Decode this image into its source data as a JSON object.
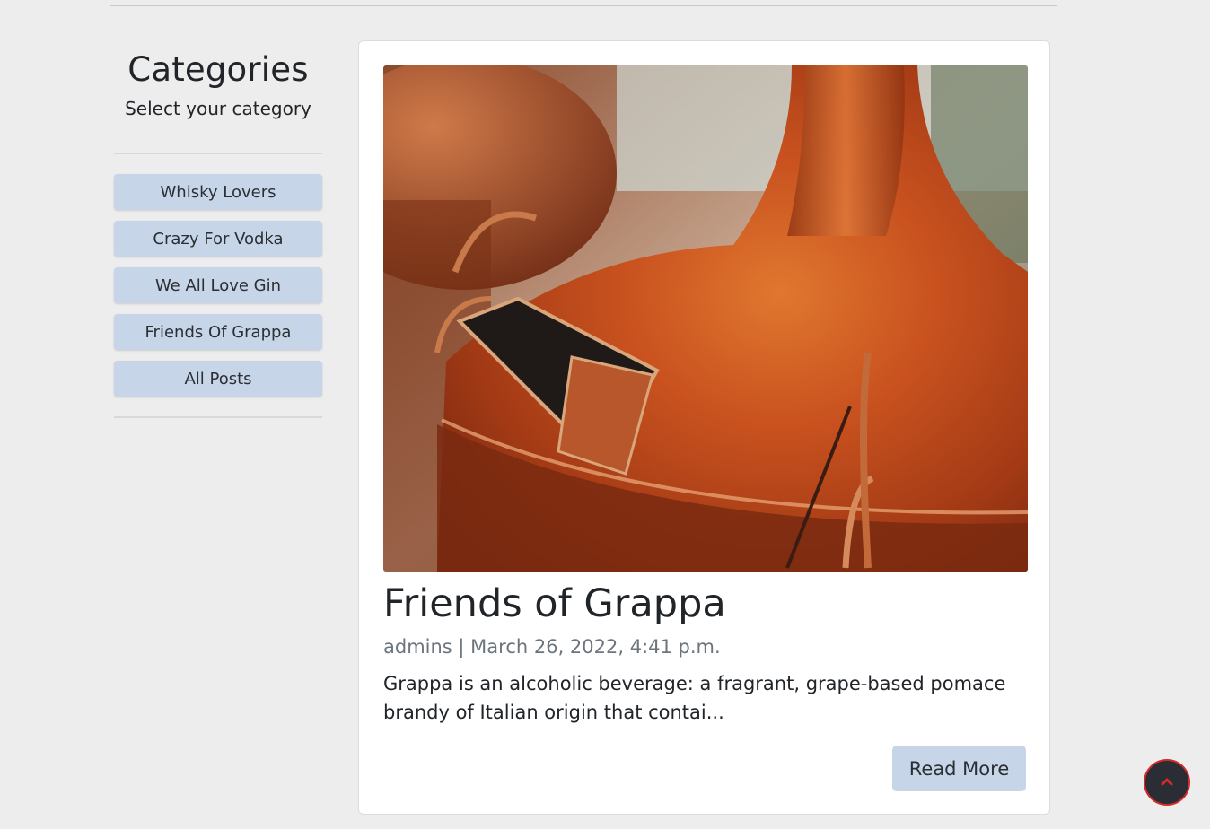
{
  "sidebar": {
    "title": "Categories",
    "subtitle": "Select your category",
    "categories": [
      {
        "label": "Whisky Lovers"
      },
      {
        "label": "Crazy For Vodka"
      },
      {
        "label": "We All Love Gin"
      },
      {
        "label": "Friends Of Grappa"
      },
      {
        "label": "All Posts"
      }
    ]
  },
  "post": {
    "image_alt": "copper distillation still",
    "title": "Friends of Grappa",
    "meta": "admins | March 26, 2022, 4:41 p.m.",
    "excerpt": "Grappa is an alcoholic beverage: a fragrant, grape-based pomace brandy of Italian origin that contai...",
    "read_more_label": "Read More"
  },
  "back_to_top": {
    "icon": "chevron-up-icon"
  },
  "colors": {
    "page_bg": "#ededed",
    "button_bg": "#c7d5e8",
    "meta_text": "#6c757d",
    "back_to_top_bg": "#2a2d33",
    "back_to_top_accent": "#d12b2b",
    "copper": "#b8451e"
  }
}
